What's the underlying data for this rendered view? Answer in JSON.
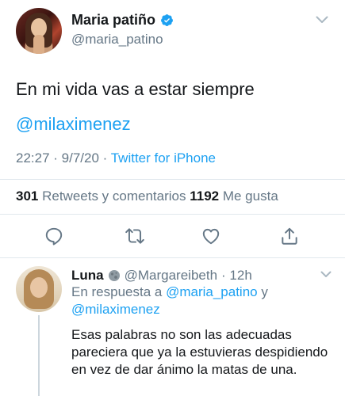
{
  "tweet": {
    "author_name": "Maria patiño",
    "author_handle": "@maria_patino",
    "text_line1": "En mi vida vas a estar siempre",
    "text_mention": "@milaximenez",
    "time": "22:27 · 9/7/20 · ",
    "source": "Twitter for iPhone",
    "retweets_count": "301",
    "retweets_label": " Retweets y comentarios ",
    "likes_count": "1192",
    "likes_label": " Me gusta"
  },
  "actions": {
    "reply_icon": "reply-icon",
    "retweet_icon": "retweet-icon",
    "like_icon": "heart-icon",
    "share_icon": "share-icon"
  },
  "reply": {
    "author_name": "Luna",
    "author_handle": "@Margareibeth",
    "age": "· 12h",
    "replying_prefix": "En respuesta a ",
    "replying_to_1": "@maria_patino",
    "replying_joiner": " y",
    "replying_to_2": "@milaximenez",
    "text": "Esas palabras no son las adecuadas pareciera que ya la estuvieras despidiendo en vez de dar ánimo la matas de una."
  },
  "colors": {
    "accent": "#1da1f2",
    "secondary_text": "#657786",
    "primary_text": "#14171a",
    "divider": "#e1e8ed"
  }
}
